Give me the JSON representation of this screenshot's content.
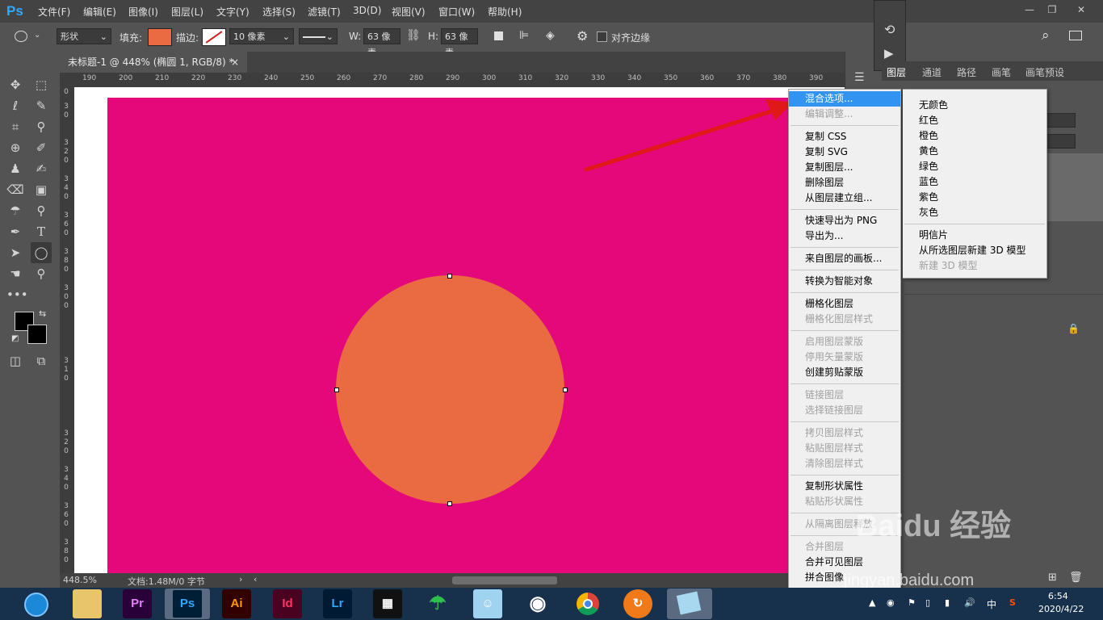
{
  "app": {
    "logo": "Ps"
  },
  "menu": [
    "文件(F)",
    "编辑(E)",
    "图像(I)",
    "图层(L)",
    "文字(Y)",
    "选择(S)",
    "滤镜(T)",
    "3D(D)",
    "视图(V)",
    "窗口(W)",
    "帮助(H)"
  ],
  "options": {
    "mode": "形状",
    "fill_label": "填充:",
    "fill_color": "#ea6a42",
    "stroke_label": "描边:",
    "stroke_size": "10 像素",
    "w_label": "W:",
    "w_value": "63 像素",
    "h_label": "H:",
    "h_value": "63 像素",
    "align_edges": "对齐边缘"
  },
  "document": {
    "tab_title": "未标题-1 @ 448% (椭圆 1, RGB/8) *",
    "close": "×"
  },
  "ruler": {
    "h_ticks": [
      "190",
      "200",
      "210",
      "220",
      "230",
      "240",
      "250",
      "260",
      "270",
      "280",
      "290",
      "300",
      "310",
      "320",
      "330",
      "340",
      "350",
      "360",
      "370",
      "380",
      "390"
    ],
    "v_ticks": [
      "0",
      "3",
      "0",
      "3",
      "2",
      "0",
      "3",
      "4",
      "0",
      "3",
      "6",
      "0",
      "3",
      "8",
      "0",
      "3",
      "0",
      "0",
      "3",
      "1",
      "0",
      "3",
      "2",
      "0",
      "3",
      "4",
      "0",
      "3",
      "6",
      "0",
      "3",
      "8",
      "0"
    ]
  },
  "canvas": {
    "artboard_color": "#e4087a",
    "shape_color": "#ea6a42"
  },
  "status": {
    "zoom": "448.5%",
    "doc_info": "文档:1.48M/0 字节"
  },
  "panels": {
    "tabs": [
      "图层",
      "通道",
      "路径",
      "画笔",
      "画笔预设"
    ]
  },
  "context_menu": {
    "items": [
      {
        "label": "混合选项...",
        "state": "active"
      },
      {
        "label": "编辑调整...",
        "state": "disabled"
      },
      {
        "label": "复制 CSS",
        "state": "normal"
      },
      {
        "label": "复制 SVG",
        "state": "normal"
      },
      {
        "label": "复制图层...",
        "state": "normal"
      },
      {
        "label": "删除图层",
        "state": "normal"
      },
      {
        "label": "从图层建立组...",
        "state": "normal"
      },
      {
        "label": "快速导出为 PNG",
        "state": "normal"
      },
      {
        "label": "导出为...",
        "state": "normal"
      },
      {
        "label": "来自图层的画板...",
        "state": "normal"
      },
      {
        "label": "转换为智能对象",
        "state": "normal"
      },
      {
        "label": "栅格化图层",
        "state": "normal"
      },
      {
        "label": "栅格化图层样式",
        "state": "disabled"
      },
      {
        "label": "启用图层蒙版",
        "state": "disabled"
      },
      {
        "label": "停用矢量蒙版",
        "state": "disabled"
      },
      {
        "label": "创建剪贴蒙版",
        "state": "normal"
      },
      {
        "label": "链接图层",
        "state": "disabled"
      },
      {
        "label": "选择链接图层",
        "state": "disabled"
      },
      {
        "label": "拷贝图层样式",
        "state": "disabled"
      },
      {
        "label": "粘贴图层样式",
        "state": "disabled"
      },
      {
        "label": "清除图层样式",
        "state": "disabled"
      },
      {
        "label": "复制形状属性",
        "state": "normal"
      },
      {
        "label": "粘贴形状属性",
        "state": "disabled"
      },
      {
        "label": "从隔离图层释放",
        "state": "disabled"
      },
      {
        "label": "合并图层",
        "state": "disabled"
      },
      {
        "label": "合并可见图层",
        "state": "normal"
      },
      {
        "label": "拼合图像",
        "state": "normal"
      }
    ]
  },
  "color_menu": {
    "items": [
      {
        "label": "无颜色",
        "state": "normal"
      },
      {
        "label": "红色",
        "state": "normal"
      },
      {
        "label": "橙色",
        "state": "normal"
      },
      {
        "label": "黄色",
        "state": "normal"
      },
      {
        "label": "绿色",
        "state": "normal"
      },
      {
        "label": "蓝色",
        "state": "normal"
      },
      {
        "label": "紫色",
        "state": "normal"
      },
      {
        "label": "灰色",
        "state": "normal"
      },
      {
        "label": "明信片",
        "state": "normal"
      },
      {
        "label": "从所选图层新建 3D 模型",
        "state": "normal"
      },
      {
        "label": "新建 3D 模型",
        "state": "disabled"
      }
    ]
  },
  "taskbar": {
    "apps": [
      {
        "name": "Pr",
        "color": "#2a0038",
        "fg": "#e77cff"
      },
      {
        "name": "Ps",
        "color": "#001e36",
        "fg": "#31a8ff"
      },
      {
        "name": "Ai",
        "color": "#330000",
        "fg": "#ff9a00"
      },
      {
        "name": "Id",
        "color": "#49021f",
        "fg": "#ff3366"
      },
      {
        "name": "Lr",
        "color": "#001a33",
        "fg": "#31a8ff"
      }
    ],
    "clock_time": "6:54",
    "clock_date": "2020/4/22",
    "ime": "中"
  },
  "watermark": {
    "brand": "Baidu 经验",
    "url": "jingyan.baidu.com"
  }
}
